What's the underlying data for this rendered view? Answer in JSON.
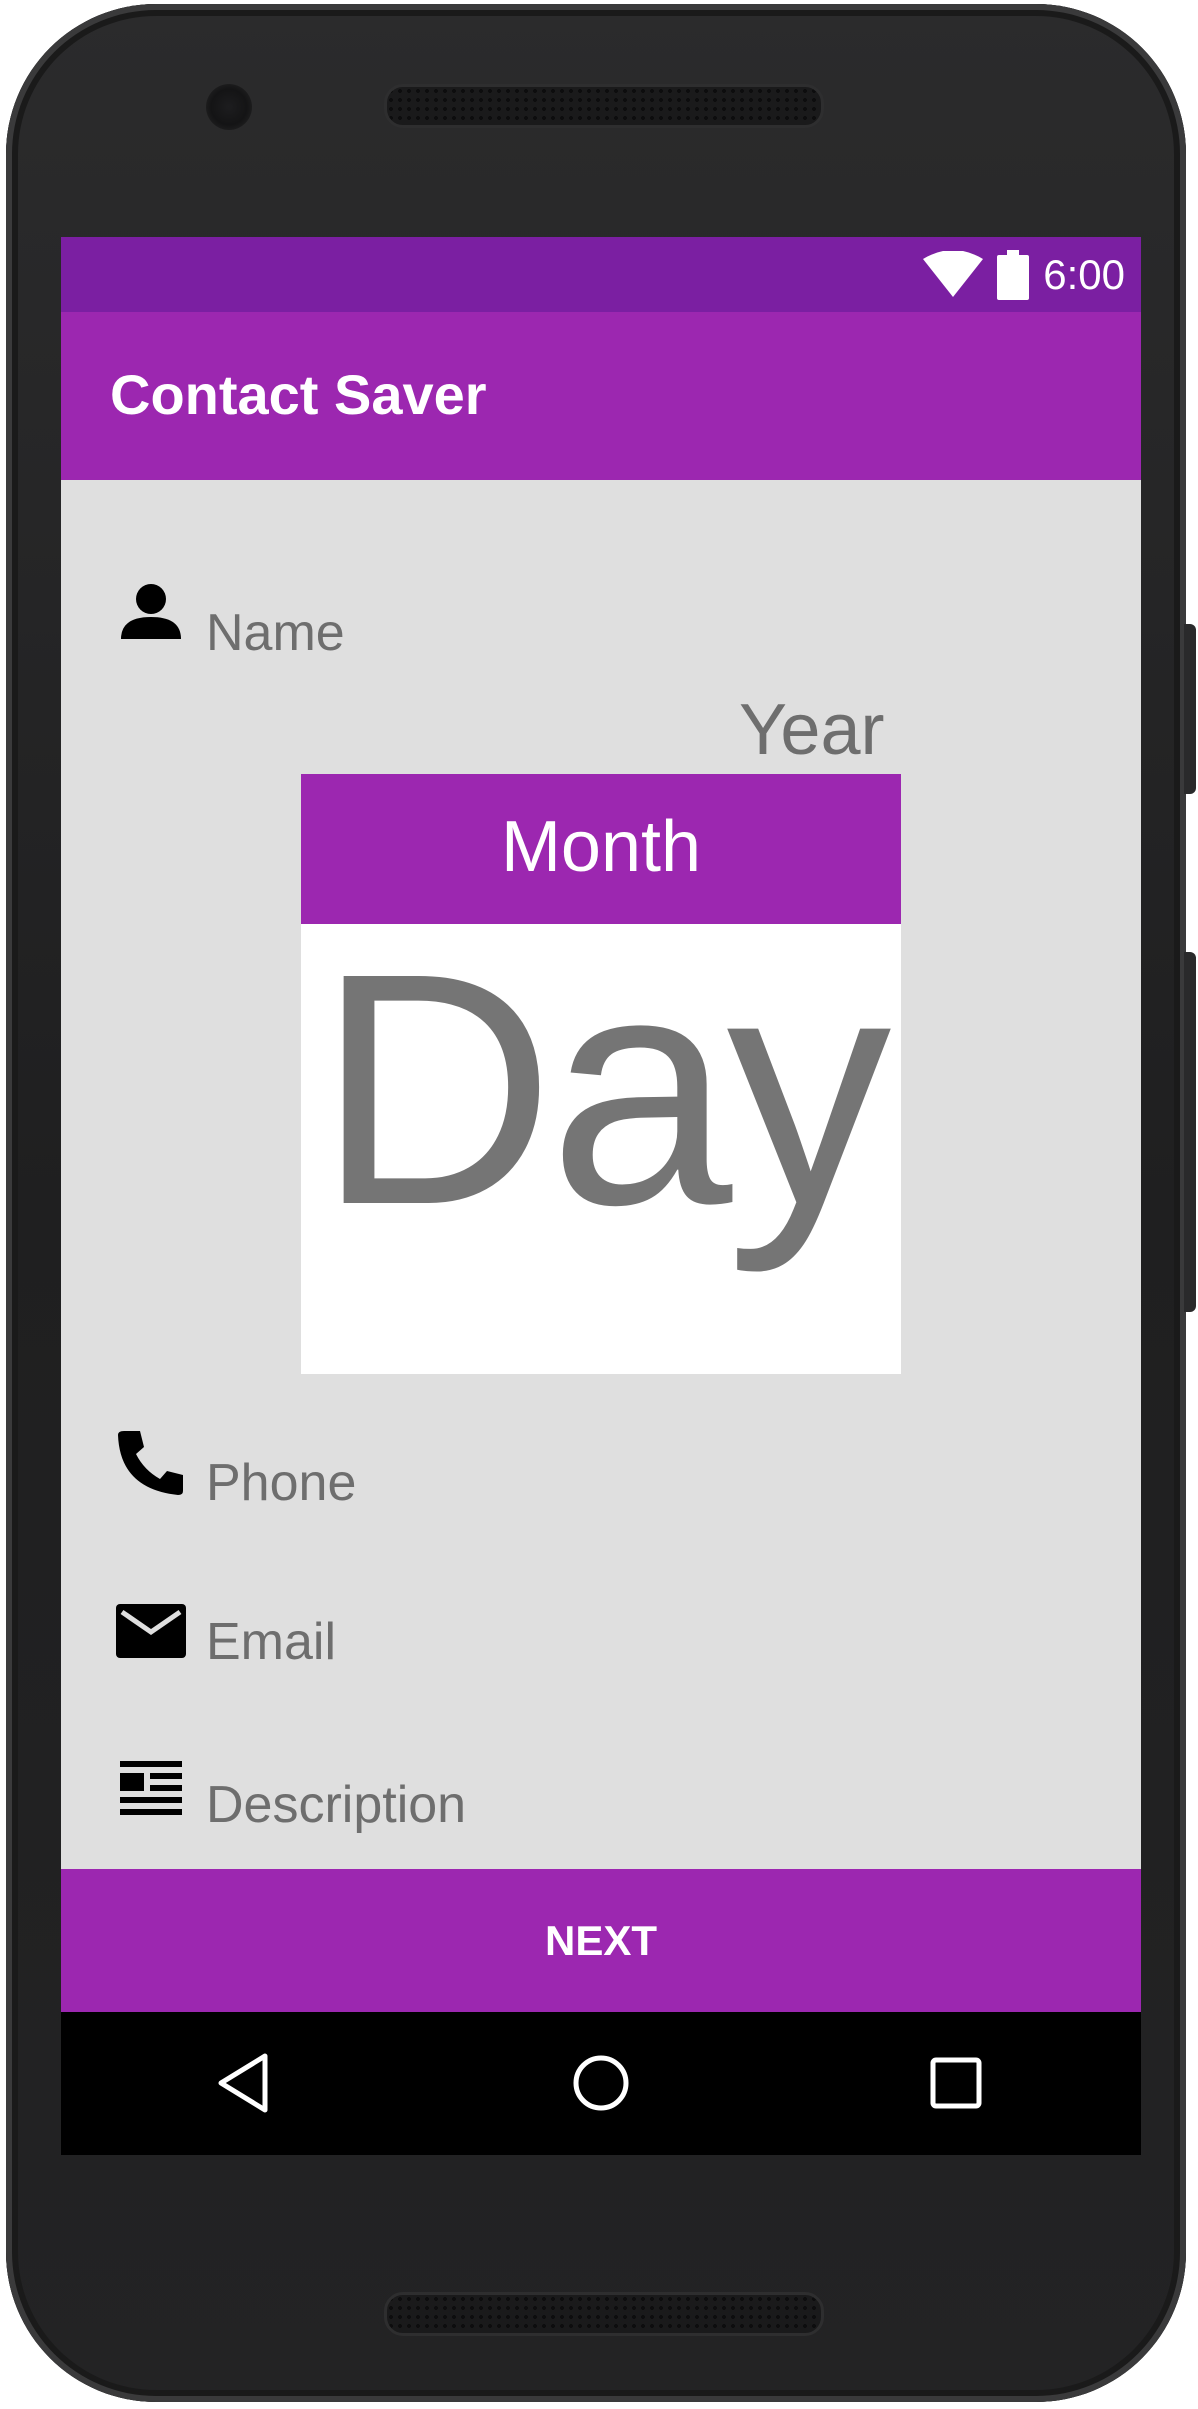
{
  "status_bar": {
    "time": "6:00",
    "icons": [
      "wifi-icon",
      "battery-icon"
    ]
  },
  "app_bar": {
    "title": "Contact Saver"
  },
  "form": {
    "name": {
      "placeholder": "Name",
      "icon": "person-icon"
    },
    "date_picker": {
      "year": "Year",
      "month": "Month",
      "day": "Day"
    },
    "phone": {
      "placeholder": "Phone",
      "icon": "phone-icon"
    },
    "email": {
      "placeholder": "Email",
      "icon": "email-icon"
    },
    "description": {
      "placeholder": "Description",
      "icon": "description-icon"
    }
  },
  "footer": {
    "next_label": "NEXT"
  },
  "nav_bar": {
    "buttons": [
      "back-icon",
      "home-icon",
      "recents-icon"
    ]
  },
  "colors": {
    "primary": "#9c27b0",
    "primary_dark": "#7b1fa2",
    "background": "#dfdfdf",
    "hint_text": "#6e6e6e"
  }
}
